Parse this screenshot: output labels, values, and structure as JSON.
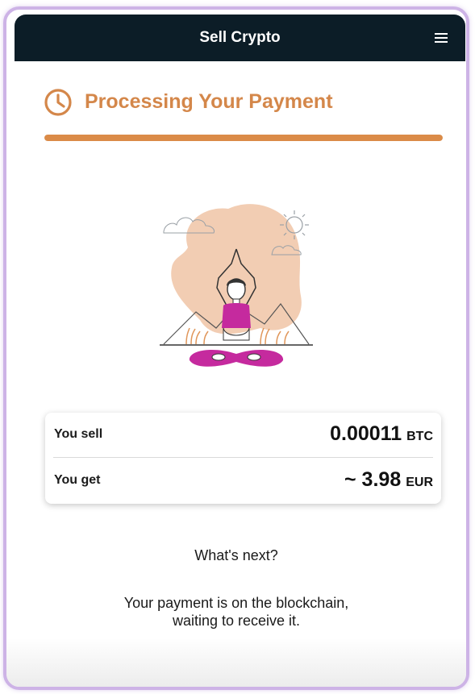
{
  "header": {
    "title": "Sell Crypto",
    "menu_icon": "hamburger-menu-icon"
  },
  "status": {
    "icon": "clock-icon",
    "title": "Processing Your Payment",
    "progress_fraction": 1.0,
    "accent_color": "#d4874a"
  },
  "illustration": {
    "icon": "meditation-illustration"
  },
  "summary": {
    "sell_label": "You sell",
    "sell_amount": "0.00011",
    "sell_unit": "BTC",
    "get_label": "You get",
    "get_amount": "~ 3.98",
    "get_unit": "EUR"
  },
  "next": {
    "heading": "What's next?",
    "line1": "Your payment is on the blockchain,",
    "line2": "waiting to receive it."
  }
}
